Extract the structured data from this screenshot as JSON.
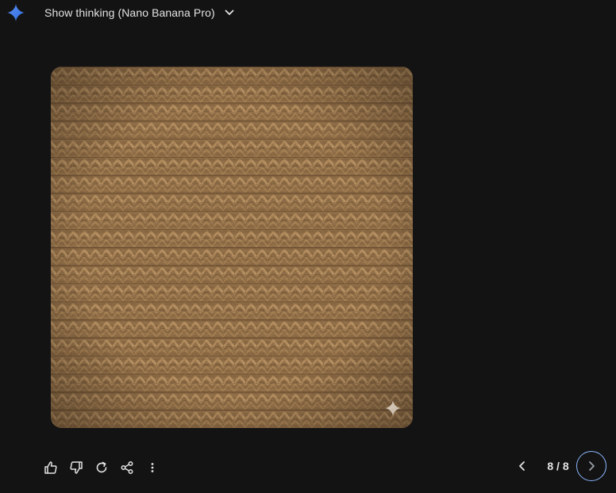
{
  "header": {
    "logo_icon": "gemini-sparkle-icon",
    "thinking_label": "Show thinking (Nano Banana Pro)",
    "expand_icon": "chevron-down-icon"
  },
  "image": {
    "watermark_icon": "sparkle-icon"
  },
  "actions": [
    {
      "name": "thumbs-up-icon"
    },
    {
      "name": "thumbs-down-icon"
    },
    {
      "name": "regenerate-icon"
    },
    {
      "name": "share-icon"
    },
    {
      "name": "more-options-icon"
    }
  ],
  "pager": {
    "count": "8 / 8",
    "prev_icon": "chevron-left-icon",
    "next_icon": "chevron-right-icon"
  },
  "colors": {
    "background": "#131314",
    "text": "#e3e3e3",
    "accent": "#8ab4f8",
    "logo_blue": "#4285f4"
  }
}
